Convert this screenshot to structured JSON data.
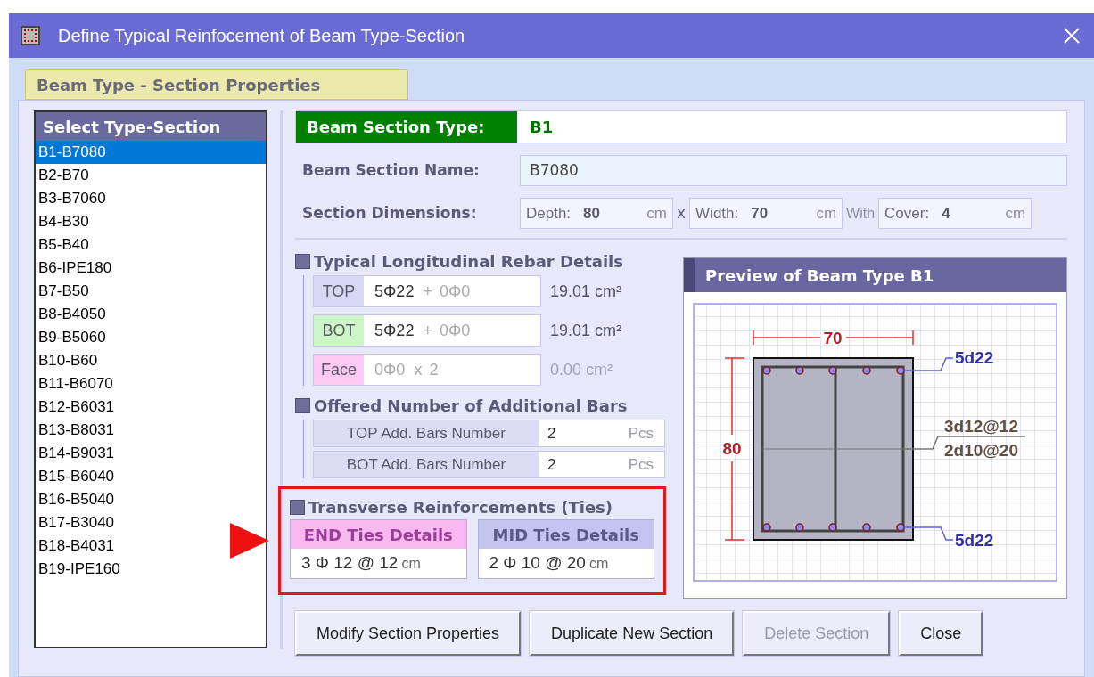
{
  "window": {
    "title": "Define Typical Reinfocement of Beam Type-Section"
  },
  "tabs": [
    {
      "label": "Beam Type - Section Properties",
      "selected": true
    }
  ],
  "type_list": {
    "title": "Select  Type-Section",
    "items": [
      {
        "label": "B1-B7080",
        "selected": true
      },
      {
        "label": "B2-B70",
        "selected": false
      },
      {
        "label": "B3-B7060",
        "selected": false
      },
      {
        "label": "B4-B30",
        "selected": false
      },
      {
        "label": "B5-B40",
        "selected": false
      },
      {
        "label": "B6-IPE180",
        "selected": false
      },
      {
        "label": "B7-B50",
        "selected": false
      },
      {
        "label": "B8-B4050",
        "selected": false
      },
      {
        "label": "B9-B5060",
        "selected": false
      },
      {
        "label": "B10-B60",
        "selected": false
      },
      {
        "label": "B11-B6070",
        "selected": false
      },
      {
        "label": "B12-B6031",
        "selected": false
      },
      {
        "label": "B13-B8031",
        "selected": false
      },
      {
        "label": "B14-B9031",
        "selected": false
      },
      {
        "label": "B15-B6040",
        "selected": false
      },
      {
        "label": "B16-B5040",
        "selected": false
      },
      {
        "label": "B17-B3040",
        "selected": false
      },
      {
        "label": "B18-B4031",
        "selected": false
      },
      {
        "label": "B19-IPE160",
        "selected": false
      }
    ]
  },
  "section_type": {
    "label": "Beam Section Type:",
    "value": "B1"
  },
  "section_name": {
    "label": "Beam Section Name:",
    "value": "B7080"
  },
  "dimensions": {
    "label": "Section Dimensions:",
    "separator_1": "x",
    "separator_2": "With",
    "fields": [
      {
        "label": "Depth:",
        "value": "80",
        "unit": "cm"
      },
      {
        "label": "Width:",
        "value": "70",
        "unit": "cm"
      },
      {
        "label": "Cover:",
        "value": "4",
        "unit": "cm"
      }
    ]
  },
  "longitudinal": {
    "title": "Typical Longitudinal Rebar Details",
    "rows": [
      {
        "kind": "top",
        "label": "TOP",
        "main": "5Φ22",
        "plus": "+",
        "extra": "0Φ0",
        "area": "19.01 cm²",
        "disabled": false
      },
      {
        "kind": "bot",
        "label": "BOT",
        "main": "5Φ22",
        "plus": "+",
        "extra": "0Φ0",
        "area": "19.01 cm²",
        "disabled": false
      },
      {
        "kind": "face",
        "label": "Face",
        "main": "0Φ0",
        "plus": "x",
        "extra": "2",
        "area": "0.00 cm²",
        "disabled": true
      }
    ]
  },
  "additional": {
    "title": "Offered Number of Additional Bars",
    "rows": [
      {
        "label": "TOP Add. Bars Number",
        "value": "2",
        "unit": "Pcs"
      },
      {
        "label": "BOT Add. Bars Number",
        "value": "2",
        "unit": "Pcs"
      }
    ]
  },
  "ties": {
    "title": "Transverse Reinforcements (Ties)",
    "groups": [
      {
        "kind": "end",
        "label": "END Ties Details",
        "value": "3  Φ  12 @ 12",
        "unit": "cm"
      },
      {
        "kind": "mid",
        "label": "MID Ties Details",
        "value": "2  Φ  10 @ 20",
        "unit": "cm"
      }
    ]
  },
  "preview": {
    "title": "Preview of Beam Type B1",
    "width_label": "70",
    "depth_label": "80",
    "top_bars": "5d22",
    "end_ties": "3d12@12",
    "mid_ties": "2d10@20",
    "bottom_bars": "5d22"
  },
  "buttons": [
    {
      "label": "Modify Section Properties",
      "disabled": false
    },
    {
      "label": "Duplicate New Section",
      "disabled": false
    },
    {
      "label": "Delete Section",
      "disabled": true
    },
    {
      "label": "Close",
      "disabled": false
    }
  ]
}
